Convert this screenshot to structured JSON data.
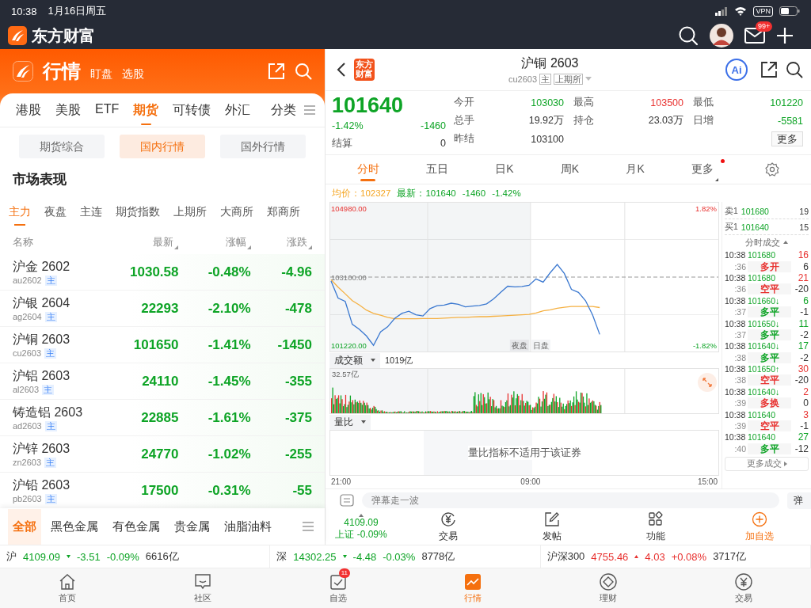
{
  "status_bar": {
    "time": "10:38",
    "date": "1月16日周五",
    "vpn": "VPN"
  },
  "app_header": {
    "brand": "东方财富",
    "mail_badge": "99+"
  },
  "left": {
    "header": {
      "title": "行情",
      "links": [
        "盯盘",
        "选股"
      ]
    },
    "tabs": [
      {
        "label": "港股",
        "selected": false
      },
      {
        "label": "美股",
        "selected": false
      },
      {
        "label": "ETF",
        "selected": false
      },
      {
        "label": "期货",
        "selected": true
      },
      {
        "label": "可转债",
        "selected": false
      },
      {
        "label": "外汇",
        "selected": false
      }
    ],
    "category_label": "分类",
    "segments": [
      {
        "label": "期货综合",
        "selected": false
      },
      {
        "label": "国内行情",
        "selected": true
      },
      {
        "label": "国外行情",
        "selected": false
      }
    ],
    "section_title": "市场表现",
    "exchange_tabs": [
      {
        "label": "主力",
        "selected": true
      },
      {
        "label": "夜盘",
        "selected": false
      },
      {
        "label": "主连",
        "selected": false
      },
      {
        "label": "期货指数",
        "selected": false
      },
      {
        "label": "上期所",
        "selected": false
      },
      {
        "label": "大商所",
        "selected": false
      },
      {
        "label": "郑商所",
        "selected": false
      }
    ],
    "columns": [
      {
        "label": "名称",
        "sortable": false
      },
      {
        "label": "最新",
        "sortable": true
      },
      {
        "label": "涨幅",
        "sortable": true
      },
      {
        "label": "涨跌",
        "sortable": true
      }
    ],
    "rows": [
      {
        "name": "沪金 2602",
        "code": "au2602",
        "badge": "主",
        "last": "1030.58",
        "pct": "-0.48%",
        "chg": "-4.96",
        "color": "#0ea426"
      },
      {
        "name": "沪银 2604",
        "code": "ag2604",
        "badge": "主",
        "last": "22293",
        "pct": "-2.10%",
        "chg": "-478",
        "color": "#0ea426"
      },
      {
        "name": "沪铜 2603",
        "code": "cu2603",
        "badge": "主",
        "last": "101650",
        "pct": "-1.41%",
        "chg": "-1450",
        "color": "#0ea426"
      },
      {
        "name": "沪铝 2603",
        "code": "al2603",
        "badge": "主",
        "last": "24110",
        "pct": "-1.45%",
        "chg": "-355",
        "color": "#0ea426"
      },
      {
        "name": "铸造铝 2603",
        "code": "ad2603",
        "badge": "主",
        "last": "22885",
        "pct": "-1.61%",
        "chg": "-375",
        "color": "#0ea426"
      },
      {
        "name": "沪锌 2603",
        "code": "zn2603",
        "badge": "主",
        "last": "24770",
        "pct": "-1.02%",
        "chg": "-255",
        "color": "#0ea426"
      },
      {
        "name": "沪铅 2603",
        "code": "pb2603",
        "badge": "主",
        "last": "17500",
        "pct": "-0.31%",
        "chg": "-55",
        "color": "#0ea426"
      }
    ],
    "categories": [
      {
        "label": "全部",
        "selected": true
      },
      {
        "label": "黑色金属",
        "selected": false
      },
      {
        "label": "有色金属",
        "selected": false
      },
      {
        "label": "贵金属",
        "selected": false
      },
      {
        "label": "油脂油料",
        "selected": false
      }
    ]
  },
  "right": {
    "title": "沪铜 2603",
    "code": "cu2603",
    "badges": [
      "主",
      "上期所"
    ],
    "logo_text": "东方财富",
    "ai_label": "Ai",
    "quote": {
      "price": "101640",
      "pct": "-1.42%",
      "chg": "-1460",
      "color": "#0ea426",
      "settle_label": "结算",
      "settle": "0",
      "stats": [
        {
          "label": "今开",
          "value": "103030",
          "color": "#0ea426"
        },
        {
          "label": "最高",
          "value": "103500",
          "color": "#e8312f"
        },
        {
          "label": "最低",
          "value": "101220",
          "color": "#0ea426"
        },
        {
          "label": "总手",
          "value": "19.92万",
          "color": "#333333"
        },
        {
          "label": "持仓",
          "value": "23.03万",
          "color": "#333333"
        },
        {
          "label": "日增",
          "value": "-5581",
          "color": "#0ea426"
        },
        {
          "label": "昨结",
          "value": "103100",
          "color": "#333333"
        }
      ],
      "more": "更多"
    },
    "periods": [
      {
        "label": "分时",
        "selected": true,
        "dot": false
      },
      {
        "label": "五日",
        "selected": false,
        "dot": false
      },
      {
        "label": "日K",
        "selected": false,
        "dot": false
      },
      {
        "label": "周K",
        "selected": false,
        "dot": false
      },
      {
        "label": "月K",
        "selected": false,
        "dot": false
      },
      {
        "label": "更多",
        "selected": false,
        "dot": true
      }
    ],
    "legend": {
      "avg": "：102327",
      "last": "：101640",
      "chg": "-1460",
      "pct": "-1.42%"
    },
    "chart_data": {
      "type": "line",
      "categories": [
        null,
        null,
        null,
        null,
        null,
        null,
        null,
        null,
        null,
        null,
        null,
        null,
        null,
        null,
        null,
        null,
        null,
        null,
        null,
        null,
        null,
        null,
        null,
        null,
        null,
        null,
        null,
        null,
        null,
        null,
        null,
        null,
        null,
        null,
        null,
        null,
        null,
        null,
        null
      ],
      "series": [
        {
          "name": "最新",
          "color": "#3a78d0",
          "values": [
            102990,
            102520,
            102430,
            101800,
            101660,
            101480,
            101220,
            101590,
            101730,
            101960,
            102100,
            102160,
            102060,
            102030,
            102230,
            102310,
            102330,
            102380,
            102350,
            102280,
            102300,
            102320,
            102360,
            102500,
            102680,
            102850,
            102830,
            102840,
            102870,
            103050,
            102960,
            103220,
            103450,
            103200,
            102760,
            102680,
            102450,
            102060,
            101520
          ]
        },
        {
          "name": "均价",
          "color": "#f5b041",
          "values": [
            103030,
            102820,
            102640,
            102450,
            102330,
            102190,
            102100,
            102050,
            101990,
            101950,
            101950,
            101950,
            101950,
            101960,
            101960,
            101960,
            101970,
            101980,
            101990,
            101990,
            102000,
            102010,
            102010,
            102020,
            102030,
            102040,
            102050,
            102060,
            102070,
            102110,
            102170,
            102200,
            102240,
            102270,
            102290,
            102290,
            102290,
            102290,
            102260
          ]
        }
      ],
      "ylim": [
        101050,
        105150
      ],
      "yticks": [
        {
          "value": 101220,
          "label": "101220.00"
        },
        {
          "value": 103100,
          "label": "103100.00"
        },
        {
          "value": 104980,
          "label": "104980.00"
        }
      ],
      "ref_lines": [
        {
          "axis": "y",
          "value": 103100
        }
      ]
    },
    "chart_extra": {
      "pct_high": "1.82%",
      "pct_low": "-1.82%",
      "sessions": [
        "夜盘",
        "日盘"
      ],
      "time_labels": [
        "21:00",
        "09:00",
        "15:00"
      ]
    },
    "volume": {
      "selector": "成交额",
      "total": "1019亿",
      "max": "32.57亿"
    },
    "ratio": {
      "selector": "量比",
      "message": "量比指标不适用于该证券"
    },
    "book": {
      "levels": [
        {
          "label": "卖1",
          "price": "101680",
          "size": "19"
        },
        {
          "label": "买1",
          "price": "101640",
          "size": "15"
        }
      ],
      "title": "分时成交",
      "more": "更多成交",
      "trades": [
        {
          "time": "10:38",
          "price": "101680",
          "volume": {
            "text": "16",
            "color": "#e8312f"
          },
          "sec": ":36",
          "type": {
            "text": "多开",
            "color": "#e8312f"
          },
          "change": "6"
        },
        {
          "time": "10:38",
          "price": "101680",
          "volume": {
            "text": "21",
            "color": "#e8312f"
          },
          "sec": ":36",
          "type": {
            "text": "空平",
            "color": "#e8312f"
          },
          "change": "-20"
        },
        {
          "time": "10:38",
          "price": "101660↓",
          "volume": {
            "text": "6",
            "color": "#0ea426"
          },
          "sec": ":37",
          "type": {
            "text": "多平",
            "color": "#0ea426"
          },
          "change": "-1"
        },
        {
          "time": "10:38",
          "price": "101650↓",
          "volume": {
            "text": "11",
            "color": "#0ea426"
          },
          "sec": ":37",
          "type": {
            "text": "多平",
            "color": "#0ea426"
          },
          "change": "-2"
        },
        {
          "time": "10:38",
          "price": "101640↓",
          "volume": {
            "text": "17",
            "color": "#0ea426"
          },
          "sec": ":38",
          "type": {
            "text": "多平",
            "color": "#0ea426"
          },
          "change": "-2"
        },
        {
          "time": "10:38",
          "price": "101650↑",
          "volume": {
            "text": "30",
            "color": "#e8312f"
          },
          "sec": ":38",
          "type": {
            "text": "空平",
            "color": "#e8312f"
          },
          "change": "-20"
        },
        {
          "time": "10:38",
          "price": "101640↓",
          "volume": {
            "text": "2",
            "color": "#e8312f"
          },
          "sec": ":39",
          "type": {
            "text": "多换",
            "color": "#e8312f"
          },
          "change": "0"
        },
        {
          "time": "10:38",
          "price": "101640",
          "volume": {
            "text": "3",
            "color": "#e8312f"
          },
          "sec": ":39",
          "type": {
            "text": "空平",
            "color": "#e8312f"
          },
          "change": "-1"
        },
        {
          "time": "10:38",
          "price": "101640",
          "volume": {
            "text": "27",
            "color": "#0ea426"
          },
          "sec": ":40",
          "type": {
            "text": "多平",
            "color": "#0ea426"
          },
          "change": "-12"
        }
      ]
    },
    "comment": {
      "placeholder": "弹幕走一波",
      "button": "弹"
    },
    "toolbar": {
      "index_value": "4109.09",
      "index_label": "上证 -0.09%",
      "actions": [
        {
          "label": "交易",
          "kind": "trade"
        },
        {
          "label": "发帖",
          "kind": "post"
        },
        {
          "label": "功能",
          "kind": "grid"
        },
        {
          "label": "加自选",
          "kind": "add"
        }
      ]
    }
  },
  "tickers": [
    {
      "name": "沪",
      "value": "4109.09",
      "chg": "-3.51",
      "pct": "-0.09%",
      "amount": "6616亿",
      "color": "#0ea426"
    },
    {
      "name": "深",
      "value": "14302.25",
      "chg": "-4.48",
      "pct": "-0.03%",
      "amount": "8778亿",
      "color": "#0ea426"
    },
    {
      "name": "沪深300",
      "value": "4755.46",
      "chg": "4.03",
      "pct": "+0.08%",
      "amount": "3717亿",
      "color": "#e8312f"
    }
  ],
  "nav": [
    {
      "label": "首页",
      "kind": "home",
      "selected": false
    },
    {
      "label": "社区",
      "kind": "community",
      "selected": false
    },
    {
      "label": "自选",
      "kind": "watch",
      "selected": false,
      "badge": "11"
    },
    {
      "label": "行情",
      "kind": "market",
      "selected": true
    },
    {
      "label": "理财",
      "kind": "wealth",
      "selected": false
    },
    {
      "label": "交易",
      "kind": "trade",
      "selected": false
    }
  ]
}
